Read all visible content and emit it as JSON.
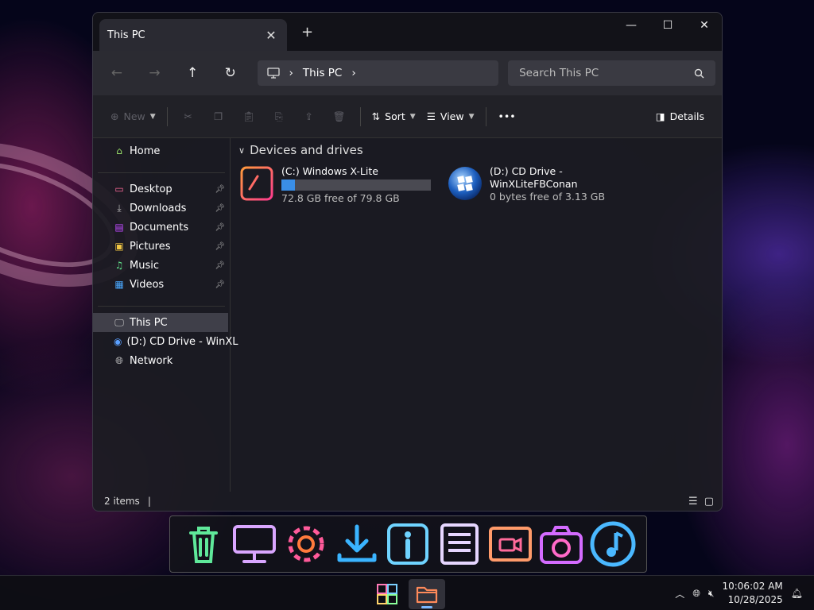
{
  "window": {
    "tab_title": "This PC",
    "tab_close": "✕",
    "tab_add": "+",
    "controls": {
      "minimize": "—",
      "maximize": "☐",
      "close": "✕"
    }
  },
  "address": {
    "back": "←",
    "forward": "→",
    "up": "↑",
    "refresh": "↻",
    "location": "This PC",
    "chevron": "›",
    "search_placeholder": "Search This PC"
  },
  "toolbar": {
    "new_label": "New",
    "sort_label": "Sort",
    "view_label": "View",
    "more_label": "•••",
    "details_label": "Details"
  },
  "sidebar": {
    "home": "Home",
    "quick": [
      {
        "label": "Desktop",
        "icon": "desktop-icon"
      },
      {
        "label": "Downloads",
        "icon": "downloads-icon"
      },
      {
        "label": "Documents",
        "icon": "documents-icon"
      },
      {
        "label": "Pictures",
        "icon": "pictures-icon"
      },
      {
        "label": "Music",
        "icon": "music-icon"
      },
      {
        "label": "Videos",
        "icon": "videos-icon"
      }
    ],
    "this_pc": "This PC",
    "cd_drive": "(D:) CD Drive - WinXL",
    "network": "Network"
  },
  "content": {
    "group_title": "Devices and drives",
    "drives": [
      {
        "name": "(C:) Windows X-Lite",
        "free": "72.8 GB free of 79.8 GB",
        "used_fraction": 0.088,
        "accent": "#3a8ee6"
      },
      {
        "name": "(D:) CD Drive - WinXLiteFBConan",
        "free": "0 bytes free of 3.13 GB"
      }
    ]
  },
  "status": {
    "items": "2 items",
    "separator": "|"
  },
  "taskbar": {
    "time": "10:06:02 AM",
    "date": "10/28/2025",
    "tray_chevron": "︿"
  },
  "dock": {
    "items": [
      "trash-icon",
      "monitor-icon",
      "settings-icon",
      "download-icon",
      "info-icon",
      "notes-icon",
      "video-icon",
      "camera-icon",
      "music-icon"
    ]
  }
}
